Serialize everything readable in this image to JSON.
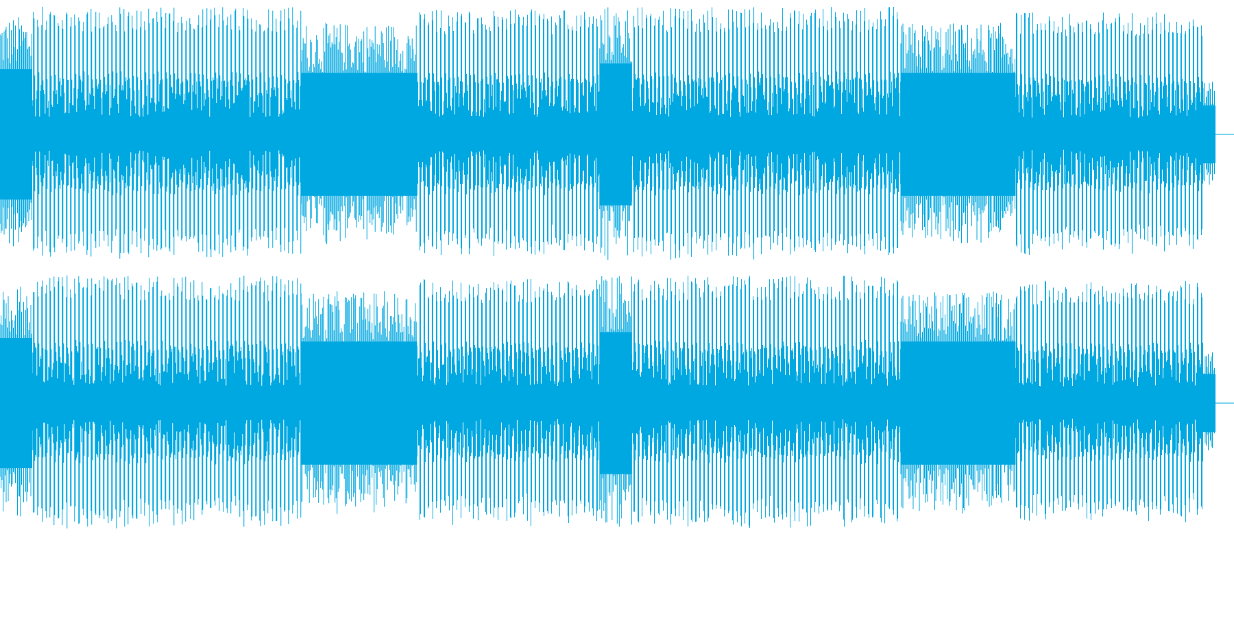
{
  "waveform": {
    "color": "#00a8e1",
    "background": "#ffffff",
    "channel_count": 2,
    "channels": [
      {
        "name": "",
        "segments": [
          {
            "from": 0.0,
            "to": 0.026,
            "level": 0.9,
            "density": "dense"
          },
          {
            "from": 0.026,
            "to": 0.244,
            "level": 0.97,
            "density": "sparse"
          },
          {
            "from": 0.244,
            "to": 0.338,
            "level": 0.85,
            "density": "dense"
          },
          {
            "from": 0.338,
            "to": 0.486,
            "level": 0.95,
            "density": "sparse"
          },
          {
            "from": 0.486,
            "to": 0.512,
            "level": 0.98,
            "density": "dense"
          },
          {
            "from": 0.512,
            "to": 0.73,
            "level": 0.97,
            "density": "sparse"
          },
          {
            "from": 0.73,
            "to": 0.823,
            "level": 0.85,
            "density": "dense"
          },
          {
            "from": 0.823,
            "to": 0.975,
            "level": 0.93,
            "density": "sparse"
          },
          {
            "from": 0.975,
            "to": 0.985,
            "level": 0.4,
            "density": "dense"
          }
        ]
      },
      {
        "name": "",
        "segments": [
          {
            "from": 0.0,
            "to": 0.026,
            "level": 0.9,
            "density": "dense"
          },
          {
            "from": 0.026,
            "to": 0.244,
            "level": 0.97,
            "density": "sparse"
          },
          {
            "from": 0.244,
            "to": 0.338,
            "level": 0.85,
            "density": "dense"
          },
          {
            "from": 0.338,
            "to": 0.486,
            "level": 0.95,
            "density": "sparse"
          },
          {
            "from": 0.486,
            "to": 0.512,
            "level": 0.98,
            "density": "dense"
          },
          {
            "from": 0.512,
            "to": 0.73,
            "level": 0.97,
            "density": "sparse"
          },
          {
            "from": 0.73,
            "to": 0.823,
            "level": 0.85,
            "density": "dense"
          },
          {
            "from": 0.823,
            "to": 0.975,
            "level": 0.93,
            "density": "sparse"
          },
          {
            "from": 0.975,
            "to": 0.985,
            "level": 0.4,
            "density": "dense"
          }
        ]
      }
    ]
  }
}
